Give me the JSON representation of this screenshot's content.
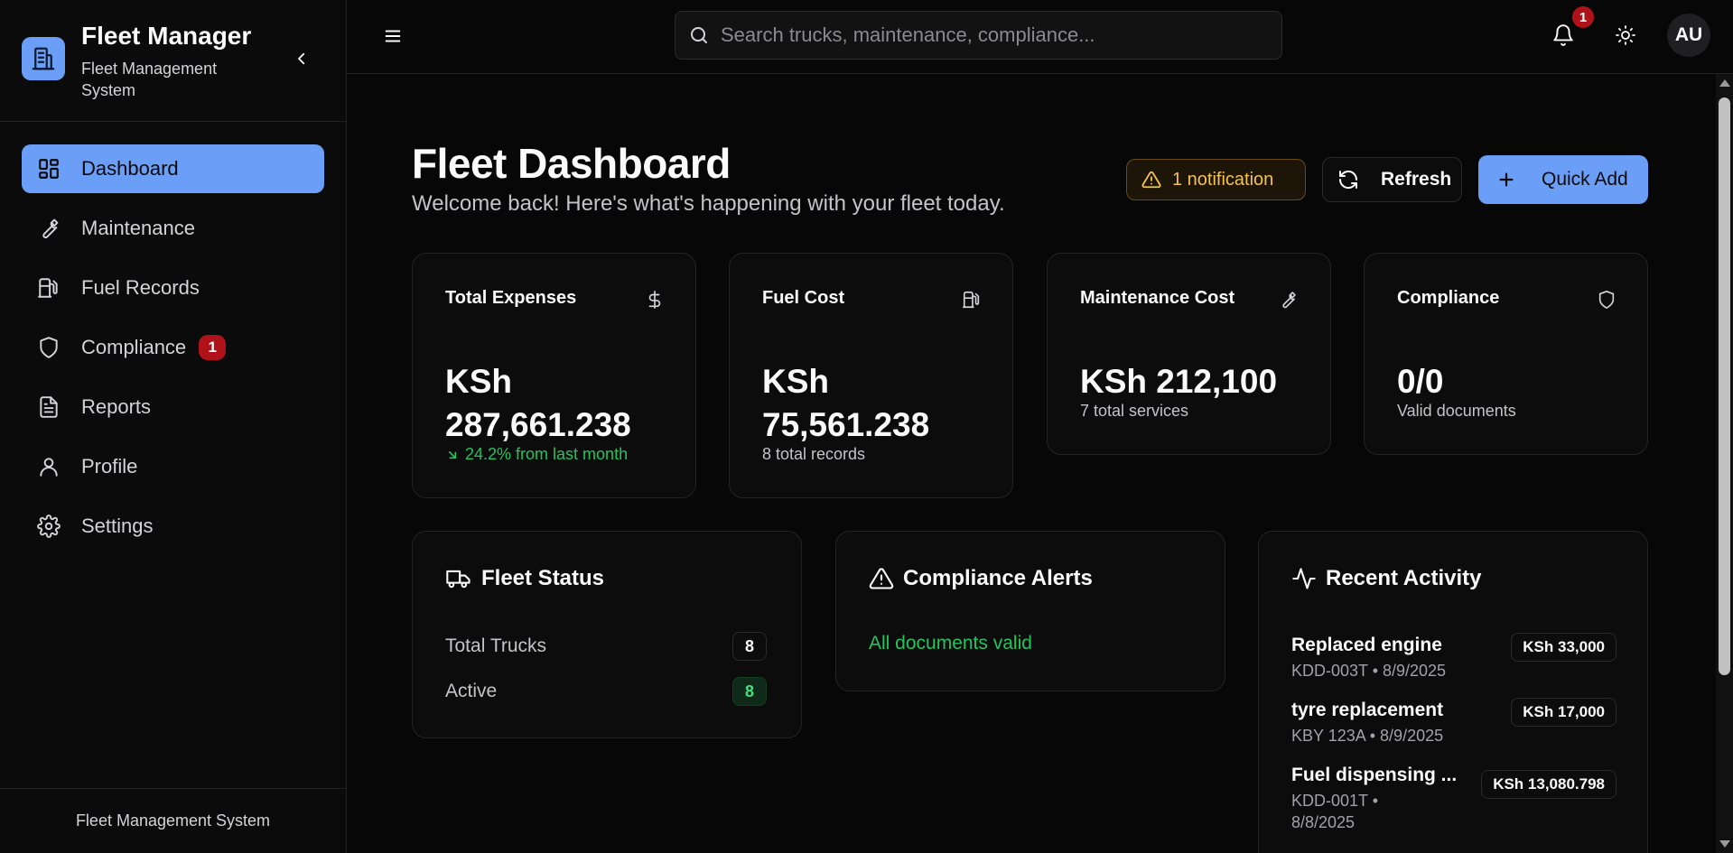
{
  "brand": {
    "title": "Fleet Manager",
    "subtitle": "Fleet Management System",
    "icon": "building-icon",
    "accent": "#6b9ef6"
  },
  "sidebar": {
    "items": [
      {
        "label": "Dashboard",
        "icon": "dashboard-grid-icon",
        "active": true
      },
      {
        "label": "Maintenance",
        "icon": "wrench-icon"
      },
      {
        "label": "Fuel Records",
        "icon": "fuel-pump-icon"
      },
      {
        "label": "Compliance",
        "icon": "shield-icon",
        "badge": "1"
      },
      {
        "label": "Reports",
        "icon": "file-text-icon"
      },
      {
        "label": "Profile",
        "icon": "user-icon"
      },
      {
        "label": "Settings",
        "icon": "gear-icon"
      }
    ],
    "footer": "Fleet Management System"
  },
  "header": {
    "search_placeholder": "Search trucks, maintenance, compliance...",
    "notifications_count": "1",
    "avatar_initials": "AU"
  },
  "page": {
    "title": "Fleet Dashboard",
    "subtitle": "Welcome back! Here's what's happening with your fleet today.",
    "notification_pill": "1 notification",
    "refresh_label": "Refresh",
    "quick_add_label": "Quick Add"
  },
  "stats": [
    {
      "title": "Total Expenses",
      "icon": "dollar-icon",
      "value_line1": "KSh",
      "value_line2": "287,661.238",
      "note": "24.2% from last month",
      "note_color": "#22c55e"
    },
    {
      "title": "Fuel Cost",
      "icon": "fuel-pump-icon",
      "value_line1": "KSh",
      "value_line2": "75,561.238",
      "note": "8 total records"
    },
    {
      "title": "Maintenance Cost",
      "icon": "wrench-icon",
      "value": "KSh 212,100",
      "note": "7 total services"
    },
    {
      "title": "Compliance",
      "icon": "shield-icon",
      "value": "0/0",
      "note": "Valid documents"
    }
  ],
  "fleet_status": {
    "title": "Fleet Status",
    "rows": [
      {
        "label": "Total Trucks",
        "count": "8"
      },
      {
        "label": "Active",
        "count": "8"
      }
    ]
  },
  "compliance_alerts": {
    "title": "Compliance Alerts",
    "message": "All documents valid"
  },
  "recent_activity": {
    "title": "Recent Activity",
    "items": [
      {
        "title": "Replaced engine",
        "meta": "KDD-003T • 8/9/2025",
        "amount": "KSh 33,000"
      },
      {
        "title": "tyre replacement",
        "meta": "KBY 123A • 8/9/2025",
        "amount": "KSh 17,000"
      },
      {
        "title": "Fuel dispensing ...",
        "meta_line1": "KDD-001T •",
        "meta_line2": "8/8/2025",
        "amount": "KSh 13,080.798"
      }
    ]
  }
}
